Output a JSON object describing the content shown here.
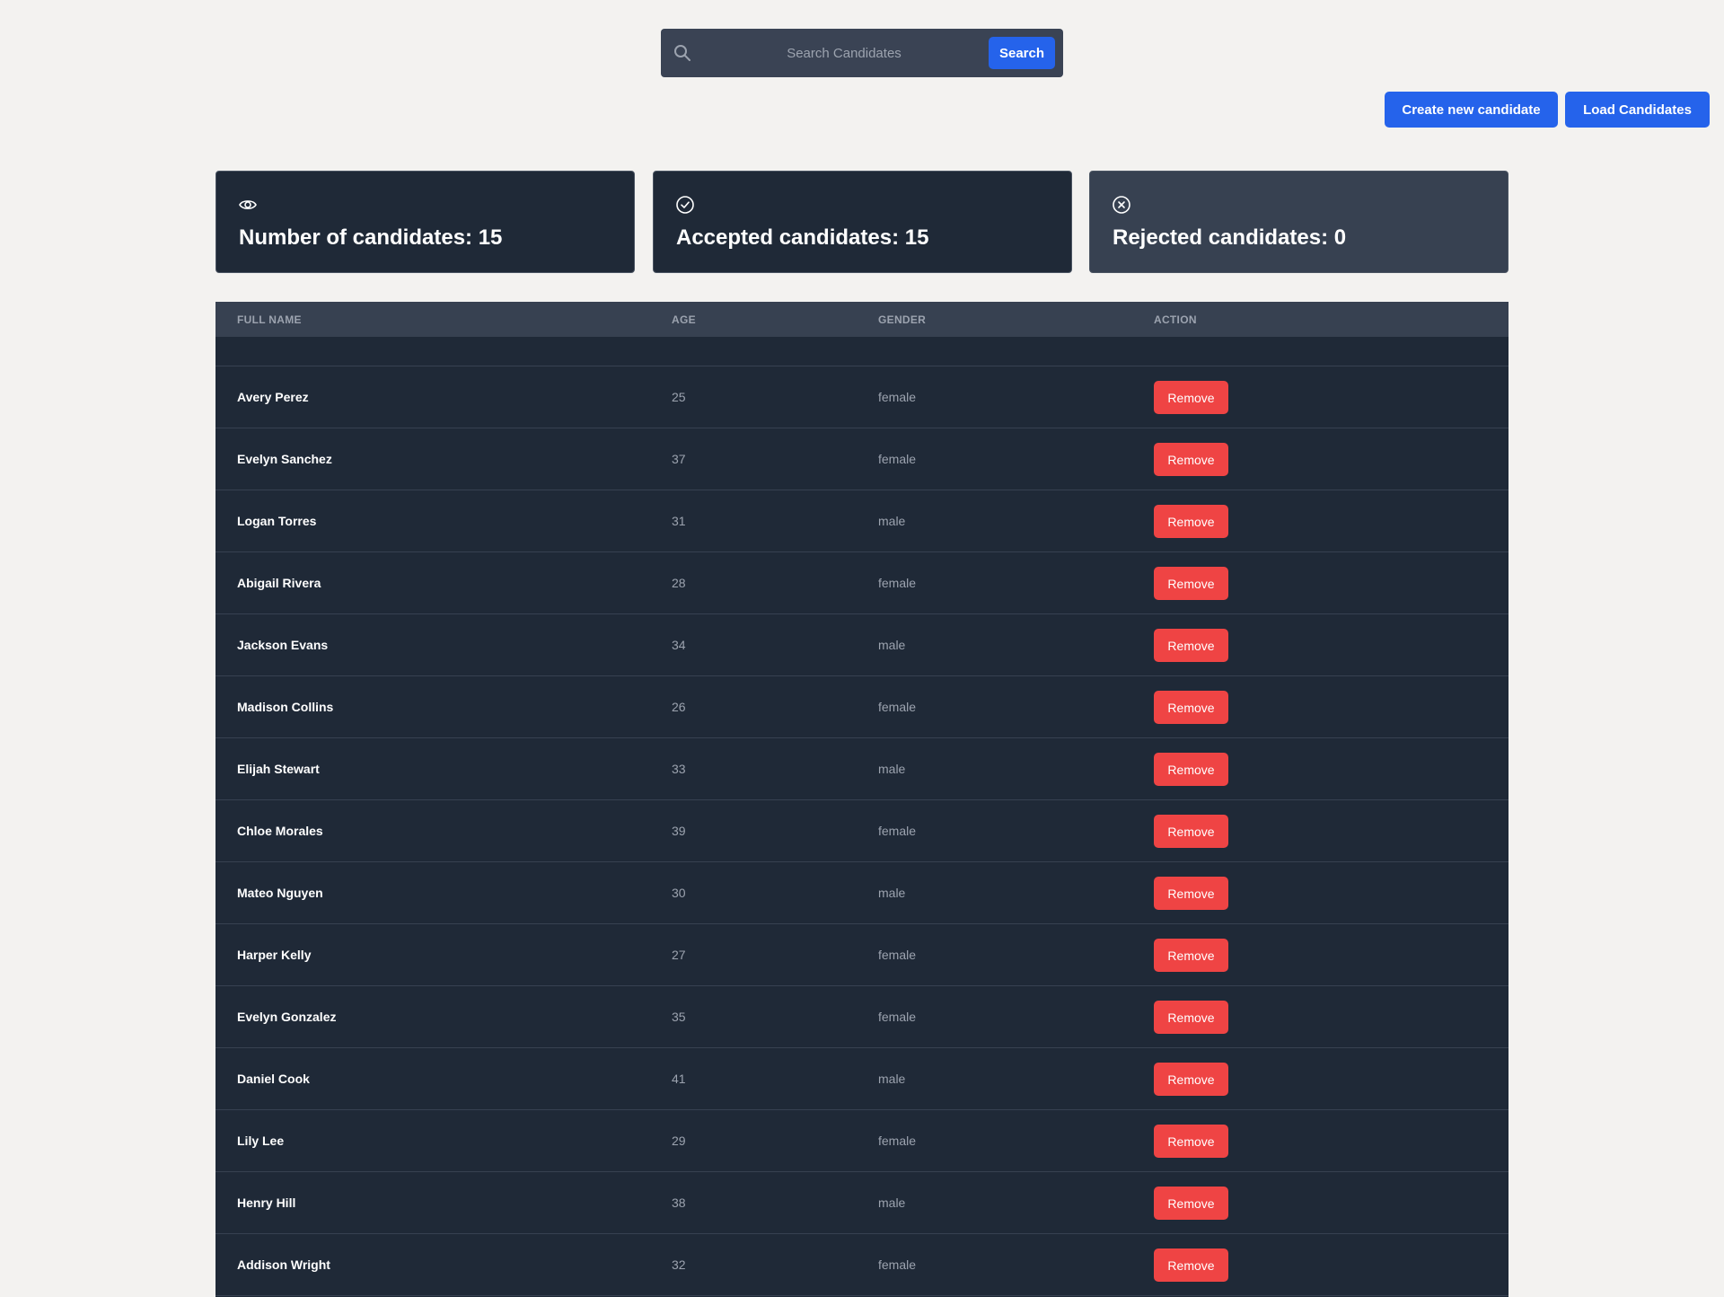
{
  "search": {
    "placeholder": "Search Candidates",
    "button_label": "Search"
  },
  "actions": {
    "create_label": "Create new candidate",
    "load_label": "Load Candidates"
  },
  "stats": {
    "total_label": "Number of candidates: 15",
    "accepted_label": "Accepted candidates: 15",
    "rejected_label": "Rejected candidates: 0"
  },
  "table": {
    "headers": {
      "name": "FULL NAME",
      "age": "AGE",
      "gender": "GENDER",
      "action": "ACTION"
    },
    "remove_label": "Remove",
    "rows": [
      {
        "name": "Avery Perez",
        "age": "25",
        "gender": "female"
      },
      {
        "name": "Evelyn Sanchez",
        "age": "37",
        "gender": "female"
      },
      {
        "name": "Logan Torres",
        "age": "31",
        "gender": "male"
      },
      {
        "name": "Abigail Rivera",
        "age": "28",
        "gender": "female"
      },
      {
        "name": "Jackson Evans",
        "age": "34",
        "gender": "male"
      },
      {
        "name": "Madison Collins",
        "age": "26",
        "gender": "female"
      },
      {
        "name": "Elijah Stewart",
        "age": "33",
        "gender": "male"
      },
      {
        "name": "Chloe Morales",
        "age": "39",
        "gender": "female"
      },
      {
        "name": "Mateo Nguyen",
        "age": "30",
        "gender": "male"
      },
      {
        "name": "Harper Kelly",
        "age": "27",
        "gender": "female"
      },
      {
        "name": "Evelyn Gonzalez",
        "age": "35",
        "gender": "female"
      },
      {
        "name": "Daniel Cook",
        "age": "41",
        "gender": "male"
      },
      {
        "name": "Lily Lee",
        "age": "29",
        "gender": "female"
      },
      {
        "name": "Henry Hill",
        "age": "38",
        "gender": "male"
      },
      {
        "name": "Addison Wright",
        "age": "32",
        "gender": "female"
      }
    ]
  },
  "icons": {
    "search": "search-icon",
    "total": "eye-icon",
    "accepted": "check-circle-icon",
    "rejected": "x-circle-icon"
  },
  "colors": {
    "page_bg": "#f3f2f0",
    "primary": "#2563eb",
    "danger": "#ef4444",
    "panel_dark": "#1f2937",
    "panel_mid": "#374151"
  }
}
